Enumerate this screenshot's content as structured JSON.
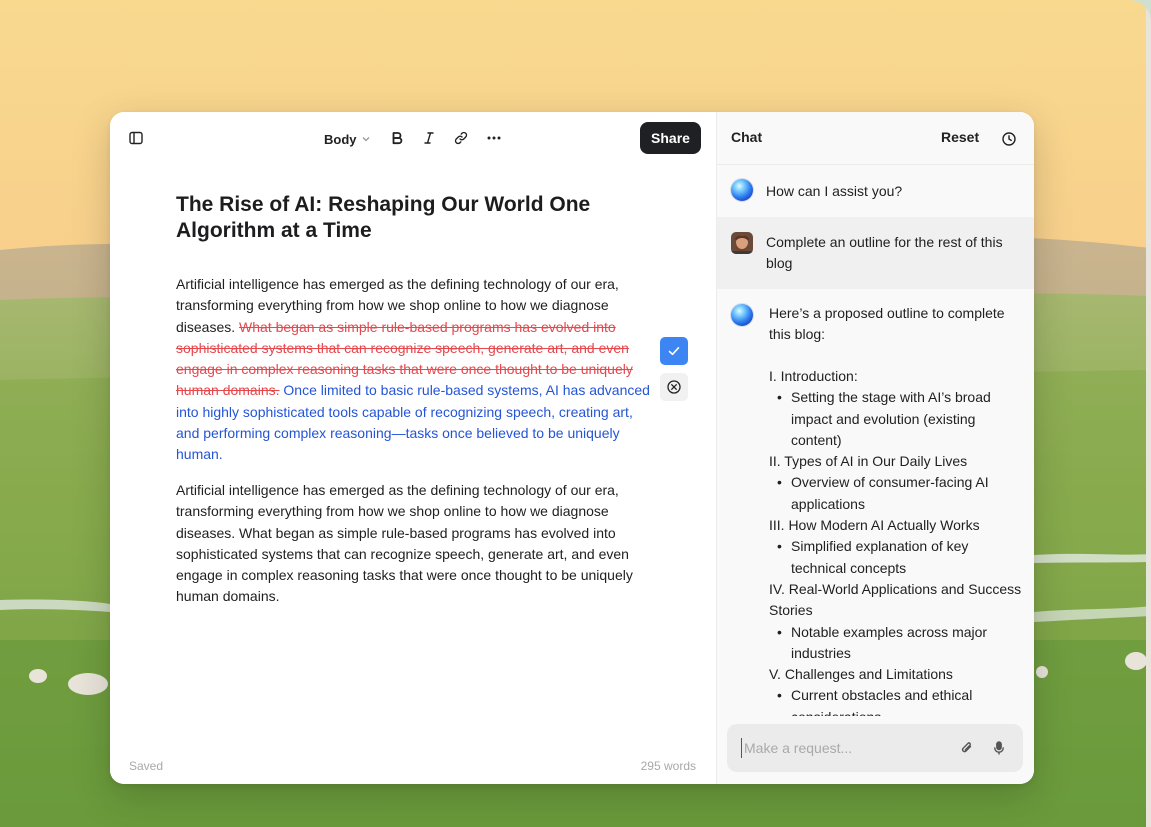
{
  "toolbar": {
    "style_label": "Body",
    "share_label": "Share",
    "icons": [
      "sidebar-toggle-icon",
      "bold-icon",
      "italic-icon",
      "link-icon",
      "more-icon"
    ]
  },
  "document": {
    "title": "The Rise of AI: Reshaping Our World One Algorithm at a Time",
    "paragraph1": {
      "lead": "Artificial intelligence has emerged as the defining technology of our era, transforming everything from how we shop online to how we diagnose diseases. ",
      "deleted": "What began as simple rule-based programs has evolved into sophisticated systems that can recognize speech, generate art, and even engage in complex reasoning tasks that were once thought to be uniquely human domains.",
      "inserted": "Once limited to basic rule-based systems, AI has advanced into highly sophisticated tools capable of recognizing speech, creating art, and performing complex reasoning—tasks once believed to be uniquely human."
    },
    "paragraph2": "Artificial intelligence has emerged as the defining technology of our era, transforming everything from how we shop online to how we diagnose diseases. What began as simple rule-based programs has evolved into sophisticated systems that can recognize speech, generate art, and even engage in complex reasoning tasks that were once thought to be uniquely human domains.",
    "status": "Saved",
    "word_count": "295 words"
  },
  "chat": {
    "title": "Chat",
    "reset_label": "Reset",
    "messages": [
      {
        "role": "assistant",
        "text": "How can I assist you?"
      },
      {
        "role": "user",
        "text": "Complete an outline for the rest of this blog"
      },
      {
        "role": "assistant",
        "intro": "Here’s a proposed outline to complete this blog:"
      }
    ],
    "outline": [
      {
        "heading": "I. Introduction:",
        "bullets": [
          "Setting the stage with AI’s broad impact and evolution (existing content)"
        ]
      },
      {
        "heading": "II. Types of AI in Our Daily Lives",
        "bullets": [
          "Overview of consumer-facing AI applications"
        ]
      },
      {
        "heading": "III. How Modern AI Actually Works",
        "bullets": [
          "Simplified explanation of key technical concepts"
        ]
      },
      {
        "heading": "IV. Real-World Applications and Success Stories",
        "bullets": [
          "Notable examples across major industries"
        ]
      },
      {
        "heading": "V. Challenges and Limitations",
        "bullets": [
          "Current obstacles and ethical considerations"
        ]
      }
    ],
    "input_placeholder": "Make a request..."
  },
  "colors": {
    "deleted_text": "#e5484d",
    "inserted_text": "#2455d6",
    "accept_button": "#3d85f3",
    "share_button": "#1f2024"
  }
}
